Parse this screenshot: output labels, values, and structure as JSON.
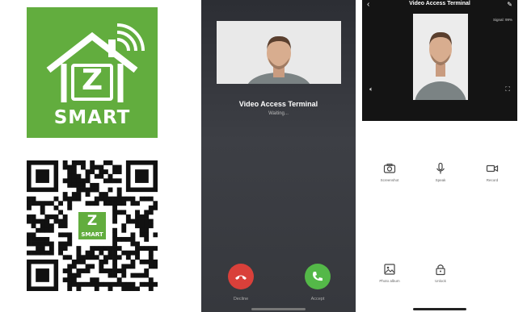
{
  "logo": {
    "letter": "Z",
    "text": "SMART",
    "color": "#62ad3e"
  },
  "qr": {
    "badge_letter": "Z",
    "badge_text": "SMART"
  },
  "incoming_call": {
    "title": "Video Access Terminal",
    "status": "Waiting...",
    "decline_label": "Decline",
    "accept_label": "Accept",
    "decline_color": "#d9403a",
    "accept_color": "#54b848"
  },
  "live_view": {
    "title": "Video Access Terminal",
    "signal": "Signal: 99%",
    "actions": [
      {
        "label": "Screenshot",
        "icon": "camera-icon"
      },
      {
        "label": "Speak",
        "icon": "microphone-icon"
      },
      {
        "label": "Record",
        "icon": "video-camera-icon"
      },
      {
        "label": "Photo album",
        "icon": "image-icon"
      },
      {
        "label": "Unlock",
        "icon": "lock-icon"
      }
    ]
  }
}
